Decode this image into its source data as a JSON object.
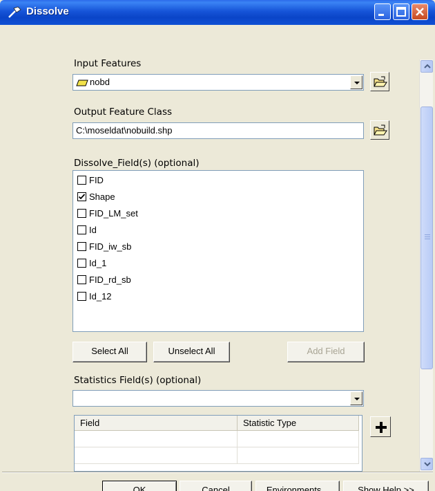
{
  "window": {
    "title": "Dissolve",
    "titlebar_color": "#0A45C8"
  },
  "input_features": {
    "label": "Input Features",
    "value": "nobd",
    "value_icon": "polygon-layer-icon",
    "browse_icon": "open-folder-icon"
  },
  "output_feature_class": {
    "label": "Output Feature Class",
    "value": "C:\\moseldat\\nobuild.shp",
    "browse_icon": "open-folder-icon"
  },
  "dissolve_fields": {
    "label": "Dissolve_Field(s) (optional)",
    "items": [
      {
        "label": "FID",
        "checked": false
      },
      {
        "label": "Shape",
        "checked": true
      },
      {
        "label": "FID_LM_set",
        "checked": false
      },
      {
        "label": "Id",
        "checked": false
      },
      {
        "label": "FID_iw_sb",
        "checked": false
      },
      {
        "label": "Id_1",
        "checked": false
      },
      {
        "label": "FID_rd_sb",
        "checked": false
      },
      {
        "label": "Id_12",
        "checked": false
      }
    ],
    "select_all_label": "Select All",
    "unselect_all_label": "Unselect All",
    "add_field_label": "Add Field"
  },
  "statistics_fields": {
    "label": "Statistics Field(s) (optional)",
    "value": "",
    "columns": [
      "Field",
      "Statistic Type"
    ],
    "add_icon": "plus-icon"
  },
  "footer": {
    "ok_label": "OK",
    "cancel_label": "Cancel",
    "environments_label": "Environments...",
    "show_help_label": "Show Help >>"
  }
}
